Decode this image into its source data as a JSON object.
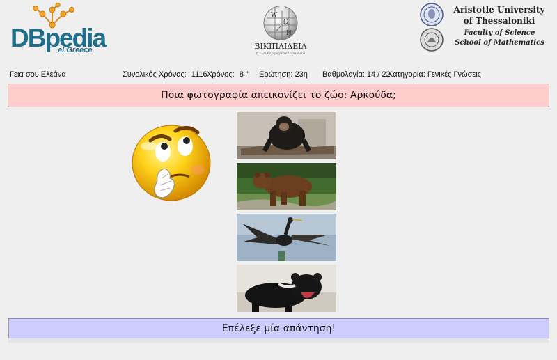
{
  "header": {
    "dbpedia_logo": {
      "word": "DBpedia",
      "sub": "el.Greece"
    },
    "wikipedia_logo": {
      "name": "ΒΙΚΙΠΑΙΔΕΙΑ",
      "tagline": "η ελεύθερη εγκυκλοπαίδεια"
    },
    "university": {
      "line1": "Aristotle University",
      "line2": "of Thessaloniki",
      "faculty": "Faculty of Science",
      "school": "School of Mathematics"
    }
  },
  "status": {
    "greeting": "Γεια σου Ελεάνα",
    "total_time_label": "Συνολικός Χρόνος:",
    "total_time_value": "1116 \"",
    "time_label": "Χρόνος:",
    "time_value": "8 \"",
    "question_label": "Ερώτηση: 23η",
    "score_label": "Βαθμολογία: 14 / 22",
    "category_label": "Κατηγορία: Γενικές Γνώσεις"
  },
  "question": {
    "text": "Ποια φωτογραφία απεικονίζει το ζώο: Αρκούδα;"
  },
  "options": [
    {
      "subject": "chimpanzee"
    },
    {
      "subject": "brown-bear"
    },
    {
      "subject": "cormorant"
    },
    {
      "subject": "tasmanian-devil"
    }
  ],
  "answer_prompt": {
    "text": "Επέλεξε μία απάντηση!"
  },
  "colors": {
    "background": "#efefef",
    "question_bg": "#ffcccc",
    "answer_bg": "#ccccff",
    "dbpedia_blue": "#1f6e8c",
    "dbpedia_orange": "#f5a623"
  }
}
